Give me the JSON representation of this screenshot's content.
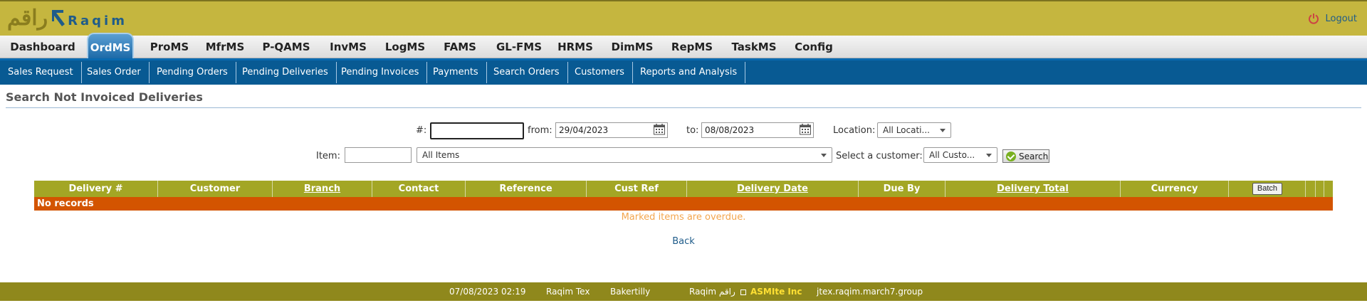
{
  "header": {
    "logo_ar": "راقم",
    "logo_en": "Raqim",
    "logout_label": "Logout"
  },
  "main_nav": {
    "items": [
      "Dashboard",
      "OrdMS",
      "ProMS",
      "MfrMS",
      "P-QAMS",
      "InvMS",
      "LogMS",
      "FAMS",
      "GL-FMS",
      "HRMS",
      "DimMS",
      "RepMS",
      "TaskMS",
      "Config"
    ],
    "active": "OrdMS"
  },
  "sub_nav": {
    "items": [
      "Sales Request",
      "Sales Order",
      "Pending Orders",
      "Pending Deliveries",
      "Pending Invoices",
      "Payments",
      "Search Orders",
      "Customers",
      "Reports and Analysis"
    ]
  },
  "page": {
    "title": "Search Not Invoiced Deliveries"
  },
  "filters": {
    "number_label": "#:",
    "number_value": "",
    "from_label": "from:",
    "from_value": "29/04/2023",
    "to_label": "to:",
    "to_value": "08/08/2023",
    "location_label": "Location:",
    "location_value": "All Locati...",
    "item_label": "Item:",
    "item_code_value": "",
    "item_value": "All Items",
    "customer_label": "Select a customer:",
    "customer_value": "All Custo...",
    "search_label": "Search"
  },
  "table": {
    "columns": [
      "Delivery #",
      "Customer",
      "Branch",
      "Contact",
      "Reference",
      "Cust Ref",
      "Delivery Date",
      "Due By",
      "Delivery Total",
      "Currency"
    ],
    "sortable_columns": [
      "Branch",
      "Delivery Date",
      "Delivery Total"
    ],
    "batch_label": "Batch",
    "empty_message": "No records"
  },
  "overdue_note": "Marked items are overdue.",
  "back_label": "Back",
  "footer": {
    "datetime": "07/08/2023 02:19",
    "tenant": "Raqim Tex",
    "user": "Bakertilly",
    "brand": "Raqim راقم",
    "company": "ASMIte Inc",
    "domain": "jtex.raqim.march7.group"
  },
  "colors": {
    "header_bg": "#c5b63f",
    "subnav_bg": "#085a93",
    "table_header_bg": "#a3a625",
    "no_records_bg": "#d35400",
    "footer_bg": "#8f881c",
    "link": "#1f5c8a"
  }
}
